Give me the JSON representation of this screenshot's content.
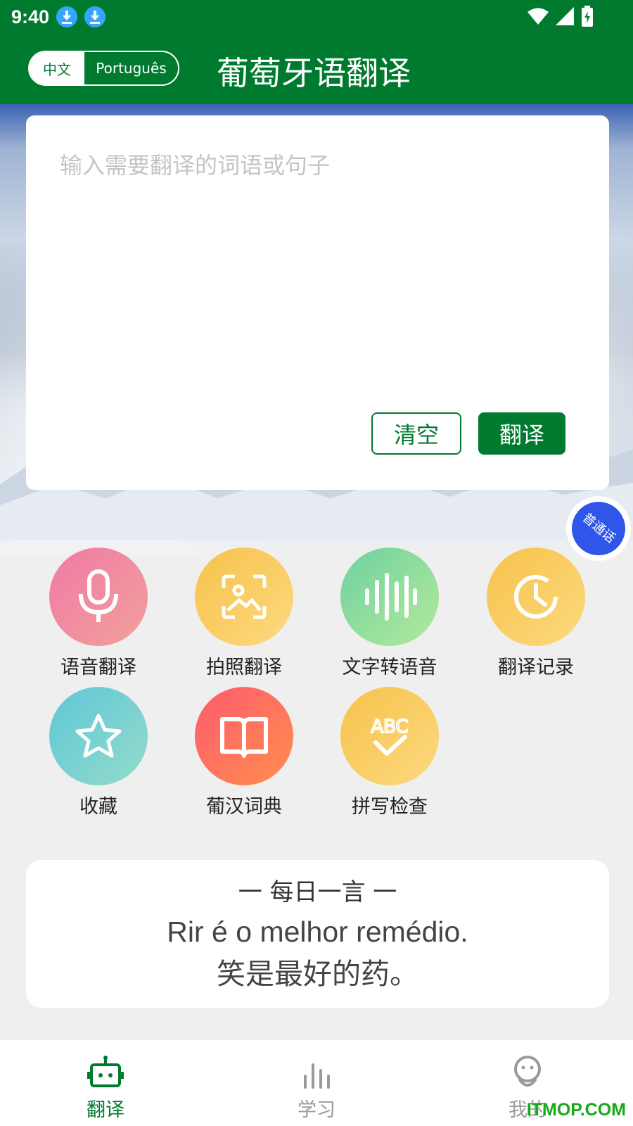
{
  "status_bar": {
    "time": "9:40"
  },
  "header": {
    "lang_zh": "中文",
    "lang_pt": "Português",
    "title": "葡萄牙语翻译"
  },
  "input": {
    "placeholder": "输入需要翻译的词语或句子",
    "clear_label": "清空",
    "translate_label": "翻译"
  },
  "mandarin_badge": "普通话",
  "features": [
    {
      "label": "语音翻译",
      "icon": "microphone-icon"
    },
    {
      "label": "拍照翻译",
      "icon": "photo-scan-icon"
    },
    {
      "label": "文字转语音",
      "icon": "sound-wave-icon"
    },
    {
      "label": "翻译记录",
      "icon": "clock-icon"
    },
    {
      "label": "收藏",
      "icon": "star-icon"
    },
    {
      "label": "葡汉词典",
      "icon": "book-icon"
    },
    {
      "label": "拼写检查",
      "icon": "abc-check-icon"
    }
  ],
  "daily_quote": {
    "title": "一  每日一言  一",
    "portuguese": "Rir é o melhor remédio.",
    "chinese": "笑是最好的药。"
  },
  "bottom_nav": [
    {
      "label": "翻译",
      "active": true
    },
    {
      "label": "学习",
      "active": false
    },
    {
      "label": "我的",
      "active": false
    }
  ],
  "watermark": "ITMOP.COM",
  "colors": {
    "brand": "#007a2f",
    "accent_blue": "#2f56e8"
  }
}
